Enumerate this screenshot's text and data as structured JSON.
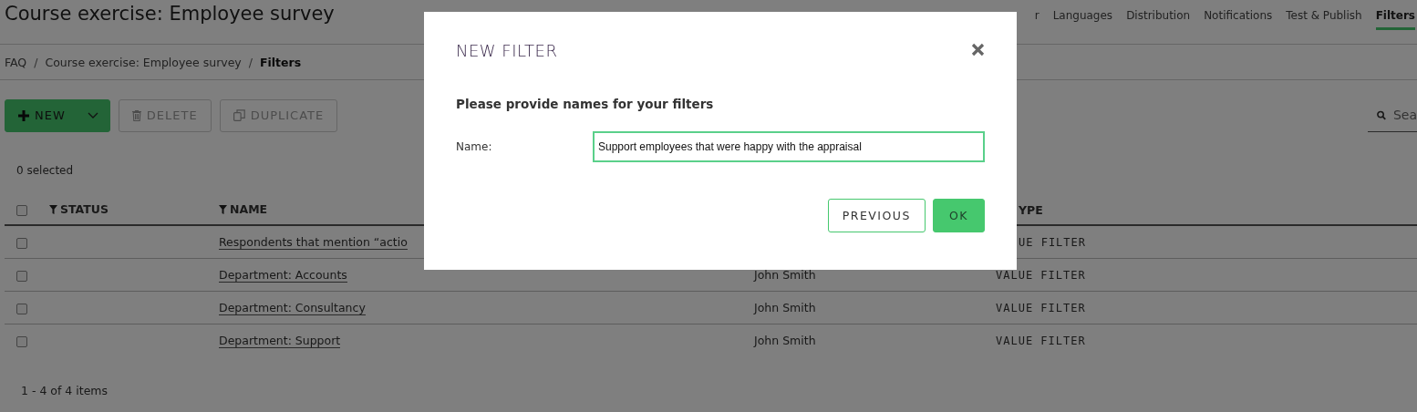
{
  "header": {
    "title": "Course exercise: Employee survey",
    "tabs": [
      {
        "label": "r",
        "selected": false
      },
      {
        "label": "Languages",
        "selected": false
      },
      {
        "label": "Distribution",
        "selected": false
      },
      {
        "label": "Notifications",
        "selected": false
      },
      {
        "label": "Test & Publish",
        "selected": false
      },
      {
        "label": "Filters",
        "selected": true
      }
    ]
  },
  "breadcrumb": [
    {
      "kind": "link",
      "label": "FAQ",
      "current": false
    },
    {
      "kind": "separator",
      "label": "/"
    },
    {
      "kind": "link",
      "label": "Course exercise: Employee survey",
      "current": false
    },
    {
      "kind": "separator",
      "label": "/"
    },
    {
      "kind": "link",
      "label": "Filters",
      "current": true
    }
  ],
  "toolbar": {
    "buttons": [
      {
        "kind": "new",
        "label": "NEW",
        "disabled": false
      },
      {
        "kind": "delete",
        "label": "DELETE",
        "disabled": true
      },
      {
        "kind": "duplicate",
        "label": "DUPLICATE",
        "disabled": true
      }
    ],
    "search": {
      "placeholder": "Sea"
    }
  },
  "selection_count": "0 selected",
  "table": {
    "all_checked": false,
    "columns": [
      {
        "label": "STATUS",
        "filter": true,
        "cut": false
      },
      {
        "label": "NAME",
        "filter": true,
        "cut": false
      },
      {
        "label": "YPE",
        "filter": false,
        "cut": true
      }
    ],
    "rows": [
      {
        "checked": false,
        "name": "Respondents that mention “actio",
        "type": "UE FILTER",
        "type_cut": true
      },
      {
        "checked": false,
        "name": "Department: Accounts",
        "author": "John Smith",
        "type": "VALUE FILTER"
      },
      {
        "checked": false,
        "name": "Department: Consultancy",
        "author": "John Smith",
        "type": "VALUE FILTER"
      },
      {
        "checked": false,
        "name": "Department: Support",
        "author": "John Smith",
        "type": "VALUE FILTER"
      }
    ]
  },
  "pager": "1 - 4 of 4 items",
  "dialog": {
    "title": "NEW FILTER",
    "subtitle": "Please provide names for your filters",
    "field_label": "Name:",
    "field_value": "Support employees that were happy with the appraisal",
    "buttons": [
      {
        "kind": "secondary",
        "label": "PREVIOUS"
      },
      {
        "kind": "primary",
        "label": "OK"
      }
    ]
  }
}
